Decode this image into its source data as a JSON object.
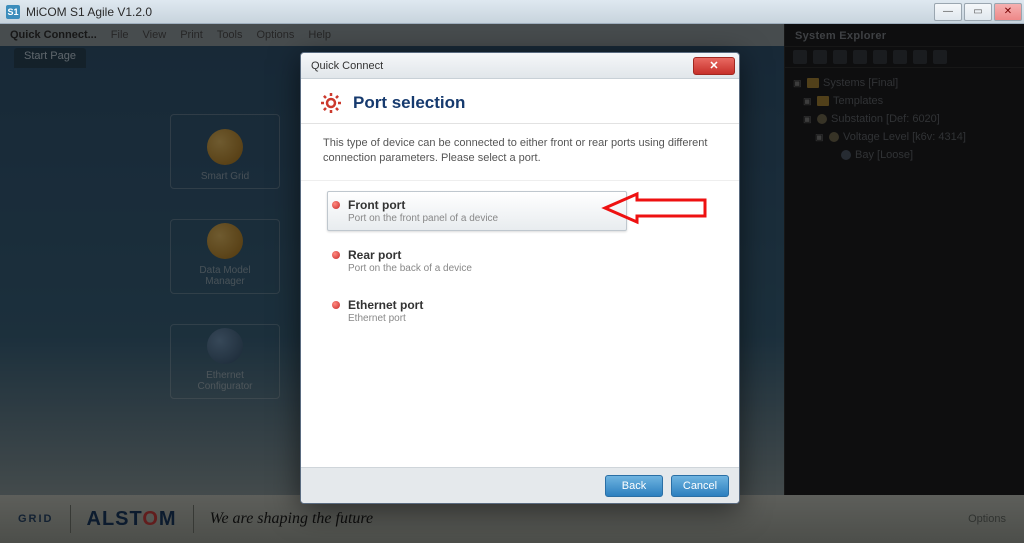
{
  "window": {
    "app_title": "MiCOM S1 Agile V1.2.0"
  },
  "menubar": {
    "quick_connect": "Quick Connect...",
    "items": [
      "File",
      "View",
      "Print",
      "Tools",
      "Options",
      "Help"
    ]
  },
  "tabs": {
    "start_page": "Start Page"
  },
  "bg_tiles": {
    "smart_grid": "Smart Grid",
    "data_model": "Data Model\nManager",
    "ethernet_conf": "Ethernet\nConfigurator"
  },
  "system_explorer": {
    "title": "System Explorer",
    "tree": {
      "root": "Systems [Final]",
      "n1": "Templates",
      "n2": "Substation [Def: 6020]",
      "n3": "Voltage Level [k6v: 4314]",
      "n4": "Bay [Loose]"
    }
  },
  "footer": {
    "grid": "GRID",
    "brand_prefix": "ALST",
    "brand_suffix": "M",
    "tagline": "We are shaping the future",
    "options": "Options"
  },
  "dialog": {
    "titlebar": "Quick Connect",
    "heading": "Port selection",
    "description": "This type of device can be connected to either front or rear ports using different connection parameters. Please select a port.",
    "options": [
      {
        "title": "Front port",
        "sub": "Port on the front panel of a device"
      },
      {
        "title": "Rear port",
        "sub": "Port on the back of a device"
      },
      {
        "title": "Ethernet port",
        "sub": "Ethernet port"
      }
    ],
    "buttons": {
      "back": "Back",
      "cancel": "Cancel"
    }
  }
}
